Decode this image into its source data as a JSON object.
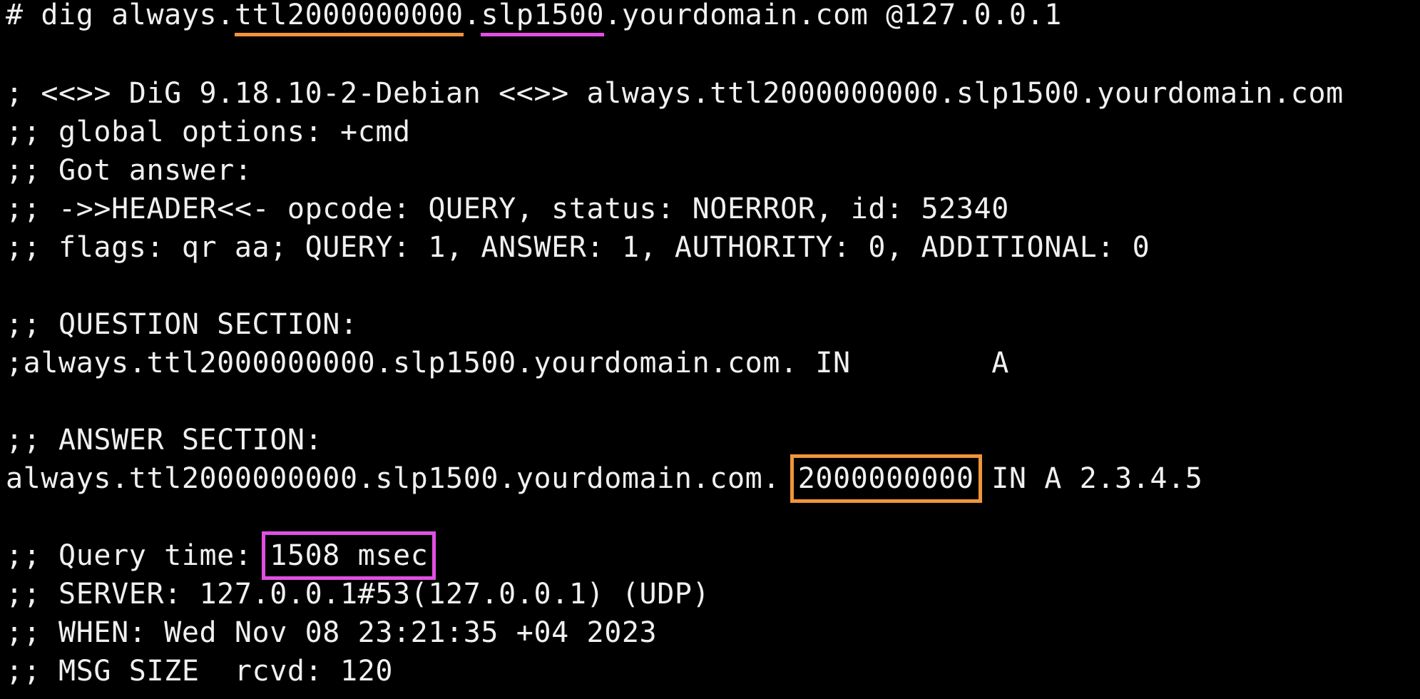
{
  "colors": {
    "background": "#000000",
    "text": "#f0f0f0",
    "highlight_ttl": "#f0953a",
    "highlight_time": "#e24fe3"
  },
  "command": {
    "prompt": "# dig always.",
    "ttl_part": "ttl2000000000",
    "dot": ".",
    "slp_part": "slp1500",
    "rest": ".yourdomain.com @127.0.0.1"
  },
  "header": {
    "dig_banner": "; <<>> DiG 9.18.10-2-Debian <<>> always.ttl2000000000.slp1500.yourdomain.com",
    "global_options": ";; global options: +cmd",
    "got_answer": ";; Got answer:",
    "header_line": ";; ->>HEADER<<- opcode: QUERY, status: NOERROR, id: 52340",
    "flags_line": ";; flags: qr aa; QUERY: 1, ANSWER: 1, AUTHORITY: 0, ADDITIONAL: 0"
  },
  "question": {
    "title": ";; QUESTION SECTION:",
    "record": ";always.ttl2000000000.slp1500.yourdomain.com. IN        A"
  },
  "answer": {
    "title": ";; ANSWER SECTION:",
    "name": "always.ttl2000000000.slp1500.yourdomain.com.",
    "ttl": "2000000000",
    "rest": "IN A 2.3.4.5"
  },
  "stats": {
    "query_time_label": ";; Query time: ",
    "query_time_value": "1508 msec",
    "server": ";; SERVER: 127.0.0.1#53(127.0.0.1) (UDP)",
    "when": ";; WHEN: Wed Nov 08 23:21:35 +04 2023",
    "msg_size": ";; MSG SIZE  rcvd: 120"
  }
}
